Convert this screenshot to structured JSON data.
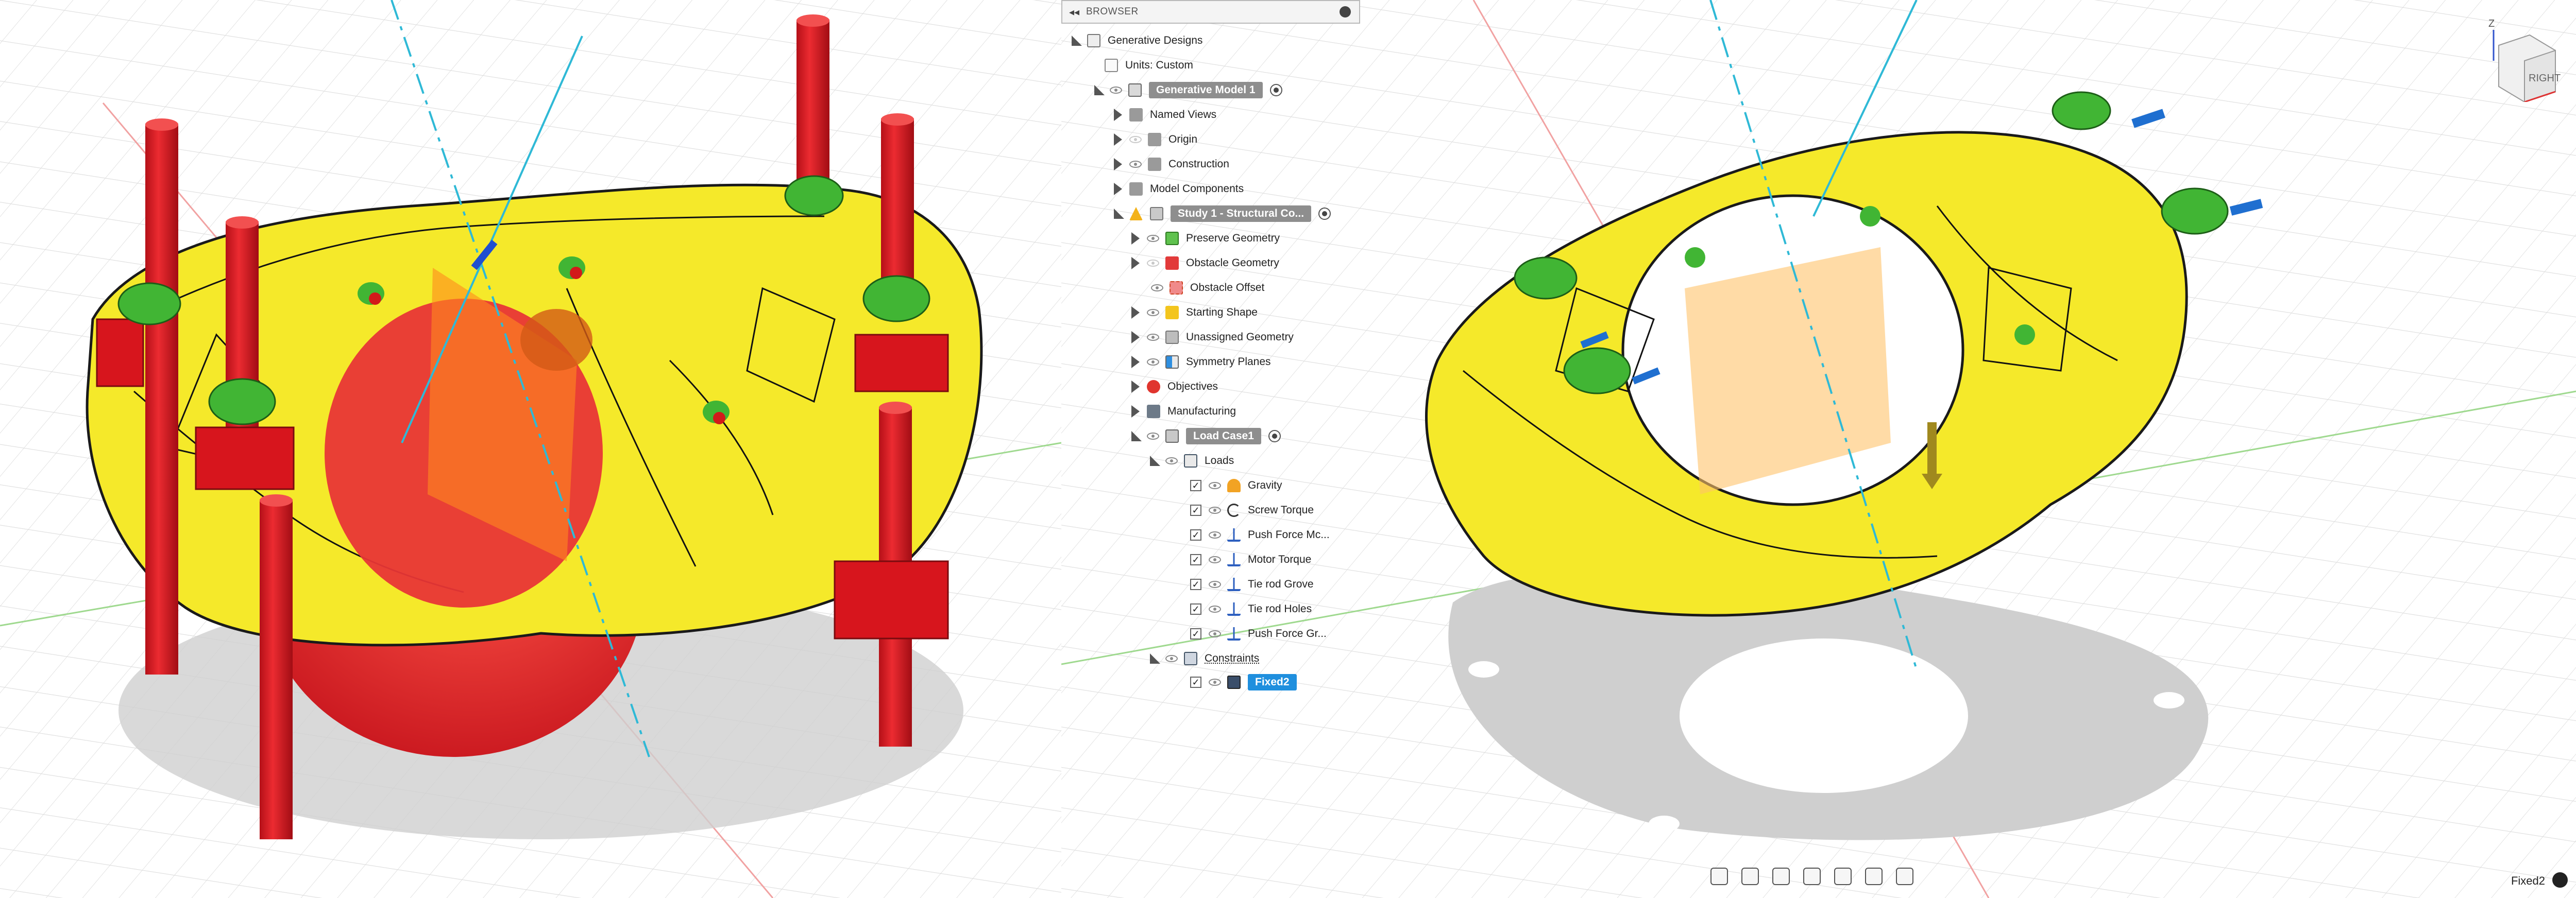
{
  "browser": {
    "title": "BROWSER",
    "collapse_glyph": "◂◂",
    "items": [
      {
        "label": "Generative Designs",
        "icon": "generative-designs-icon"
      },
      {
        "label": "Units: Custom",
        "icon": "units-icon"
      },
      {
        "label": "Generative Model 1",
        "icon": "model-icon"
      },
      {
        "label": "Named Views",
        "icon": "folder-icon"
      },
      {
        "label": "Origin",
        "icon": "folder-icon"
      },
      {
        "label": "Construction",
        "icon": "folder-icon"
      },
      {
        "label": "Model Components",
        "icon": "folder-icon"
      },
      {
        "label": "Study 1 - Structural Co...",
        "icon": "study-icon"
      },
      {
        "label": "Preserve Geometry",
        "icon": "preserve-geometry-icon"
      },
      {
        "label": "Obstacle Geometry",
        "icon": "obstacle-geometry-icon"
      },
      {
        "label": "Obstacle Offset",
        "icon": "obstacle-offset-icon"
      },
      {
        "label": "Starting Shape",
        "icon": "starting-shape-icon"
      },
      {
        "label": "Unassigned Geometry",
        "icon": "unassigned-geometry-icon"
      },
      {
        "label": "Symmetry Planes",
        "icon": "symmetry-planes-icon"
      },
      {
        "label": "Objectives",
        "icon": "objectives-icon"
      },
      {
        "label": "Manufacturing",
        "icon": "manufacturing-icon"
      },
      {
        "label": "Load Case1",
        "icon": "load-case-icon"
      },
      {
        "label": "Loads",
        "icon": "loads-icon"
      },
      {
        "label": "Gravity",
        "icon": "gravity-icon"
      },
      {
        "label": "Screw Torque",
        "icon": "torque-icon"
      },
      {
        "label": "Push Force Mc...",
        "icon": "force-icon"
      },
      {
        "label": "Motor Torque",
        "icon": "force-icon"
      },
      {
        "label": "Tie rod Grove",
        "icon": "force-icon"
      },
      {
        "label": "Tie rod Holes",
        "icon": "force-icon"
      },
      {
        "label": "Push Force Gr...",
        "icon": "force-icon"
      },
      {
        "label": "Constraints",
        "icon": "constraints-icon"
      },
      {
        "label": "Fixed2",
        "icon": "fixed-constraint-icon"
      }
    ]
  },
  "viewcube": {
    "face": "RIGHT",
    "axis": "Z"
  },
  "status": {
    "text": "Fixed2"
  },
  "toolbar": {
    "icons": [
      "orbit-icon",
      "look-at-icon",
      "pan-icon",
      "zoom-icon",
      "zoom-fit-icon",
      "display-settings-icon",
      "grid-settings-icon"
    ]
  },
  "colors": {
    "design": "#f5e92a",
    "obstacle": "#e4232b",
    "preserve": "#3bb13b",
    "selection": "#1f8fde",
    "load_arrow": "#1f6fd0"
  }
}
